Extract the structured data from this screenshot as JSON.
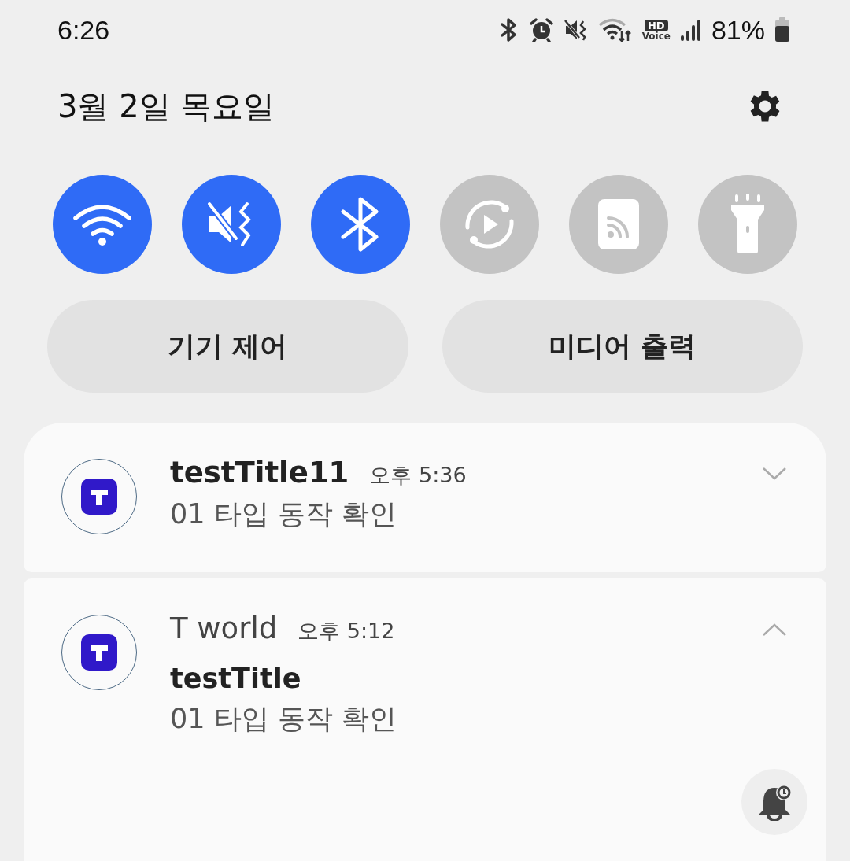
{
  "status_bar": {
    "time": "6:26",
    "hd_label": "HD",
    "voice_label": "Voice",
    "battery": "81%"
  },
  "header": {
    "date": "3월 2일 목요일"
  },
  "quick_toggles": [
    {
      "kind": "wifi",
      "on": true
    },
    {
      "kind": "mute",
      "on": true
    },
    {
      "kind": "bluetooth",
      "on": true
    },
    {
      "kind": "rotate",
      "on": false
    },
    {
      "kind": "cast",
      "on": false
    },
    {
      "kind": "flashlight",
      "on": false
    }
  ],
  "buttons": [
    "기기 제어",
    "미디어 출력"
  ],
  "notifications": [
    {
      "title": "testTitle11",
      "time": "오후 5:36",
      "body": "01 타입 동작 확인",
      "expanded": false
    },
    {
      "title": "T world",
      "time": "오후 5:12",
      "subtitle": "testTitle",
      "body": "01 타입 동작 확인",
      "expanded": true
    }
  ]
}
